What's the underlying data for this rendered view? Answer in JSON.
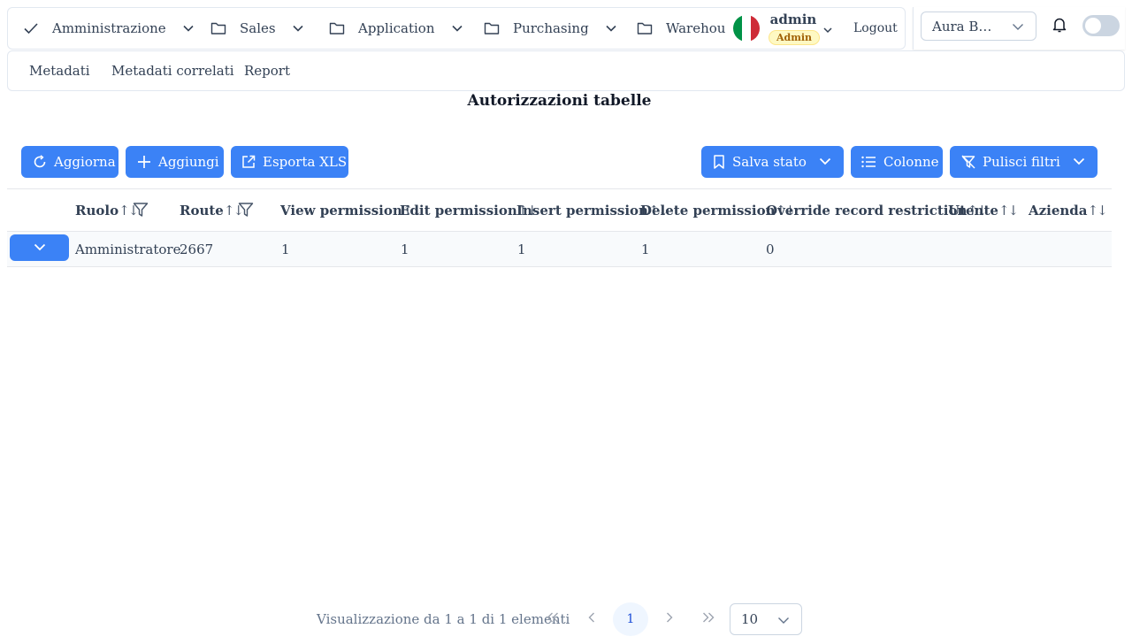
{
  "nav": {
    "items": [
      {
        "label": "Amministrazione",
        "icon": "check-icon"
      },
      {
        "label": "Sales",
        "icon": "folder-icon"
      },
      {
        "label": "Application",
        "icon": "folder-icon"
      },
      {
        "label": "Purchasing",
        "icon": "folder-icon"
      },
      {
        "label": "Warehou",
        "icon": "folder-icon"
      }
    ],
    "language_flag": "italy-flag-icon",
    "user": {
      "name": "admin",
      "role": "Admin"
    },
    "logout_label": "Logout",
    "company_select": "Aura B…"
  },
  "subnav": {
    "items": [
      "Metadati",
      "Metadati correlati",
      "Report"
    ]
  },
  "page_title": "Autorizzazioni tabelle",
  "toolbar": {
    "refresh_label": "Aggiorna",
    "add_label": "Aggiungi",
    "export_label": "Esporta XLS",
    "save_state_label": "Salva stato",
    "columns_label": "Colonne",
    "clear_filters_label": "Pulisci filtri"
  },
  "table": {
    "sort_glyph": "↑↓",
    "columns": [
      "Ruolo",
      "Route",
      "View permission",
      "Edit permission",
      "Insert permission",
      "Delete permission",
      "Override record restriction",
      "Utente",
      "Azienda"
    ],
    "rows": [
      [
        "Amministratore",
        "2667",
        "1",
        "1",
        "1",
        "1",
        "0",
        "",
        ""
      ]
    ]
  },
  "pagination": {
    "summary": "Visualizzazione da 1 a 1 di 1 elementi",
    "first": "«",
    "prev": "‹",
    "current_page": "1",
    "next": "›",
    "last": "»",
    "rows_per_page": "10"
  },
  "colors": {
    "primary": "#3b82f6",
    "border": "#e2e8f0",
    "badge_bg": "#fef9c3"
  }
}
